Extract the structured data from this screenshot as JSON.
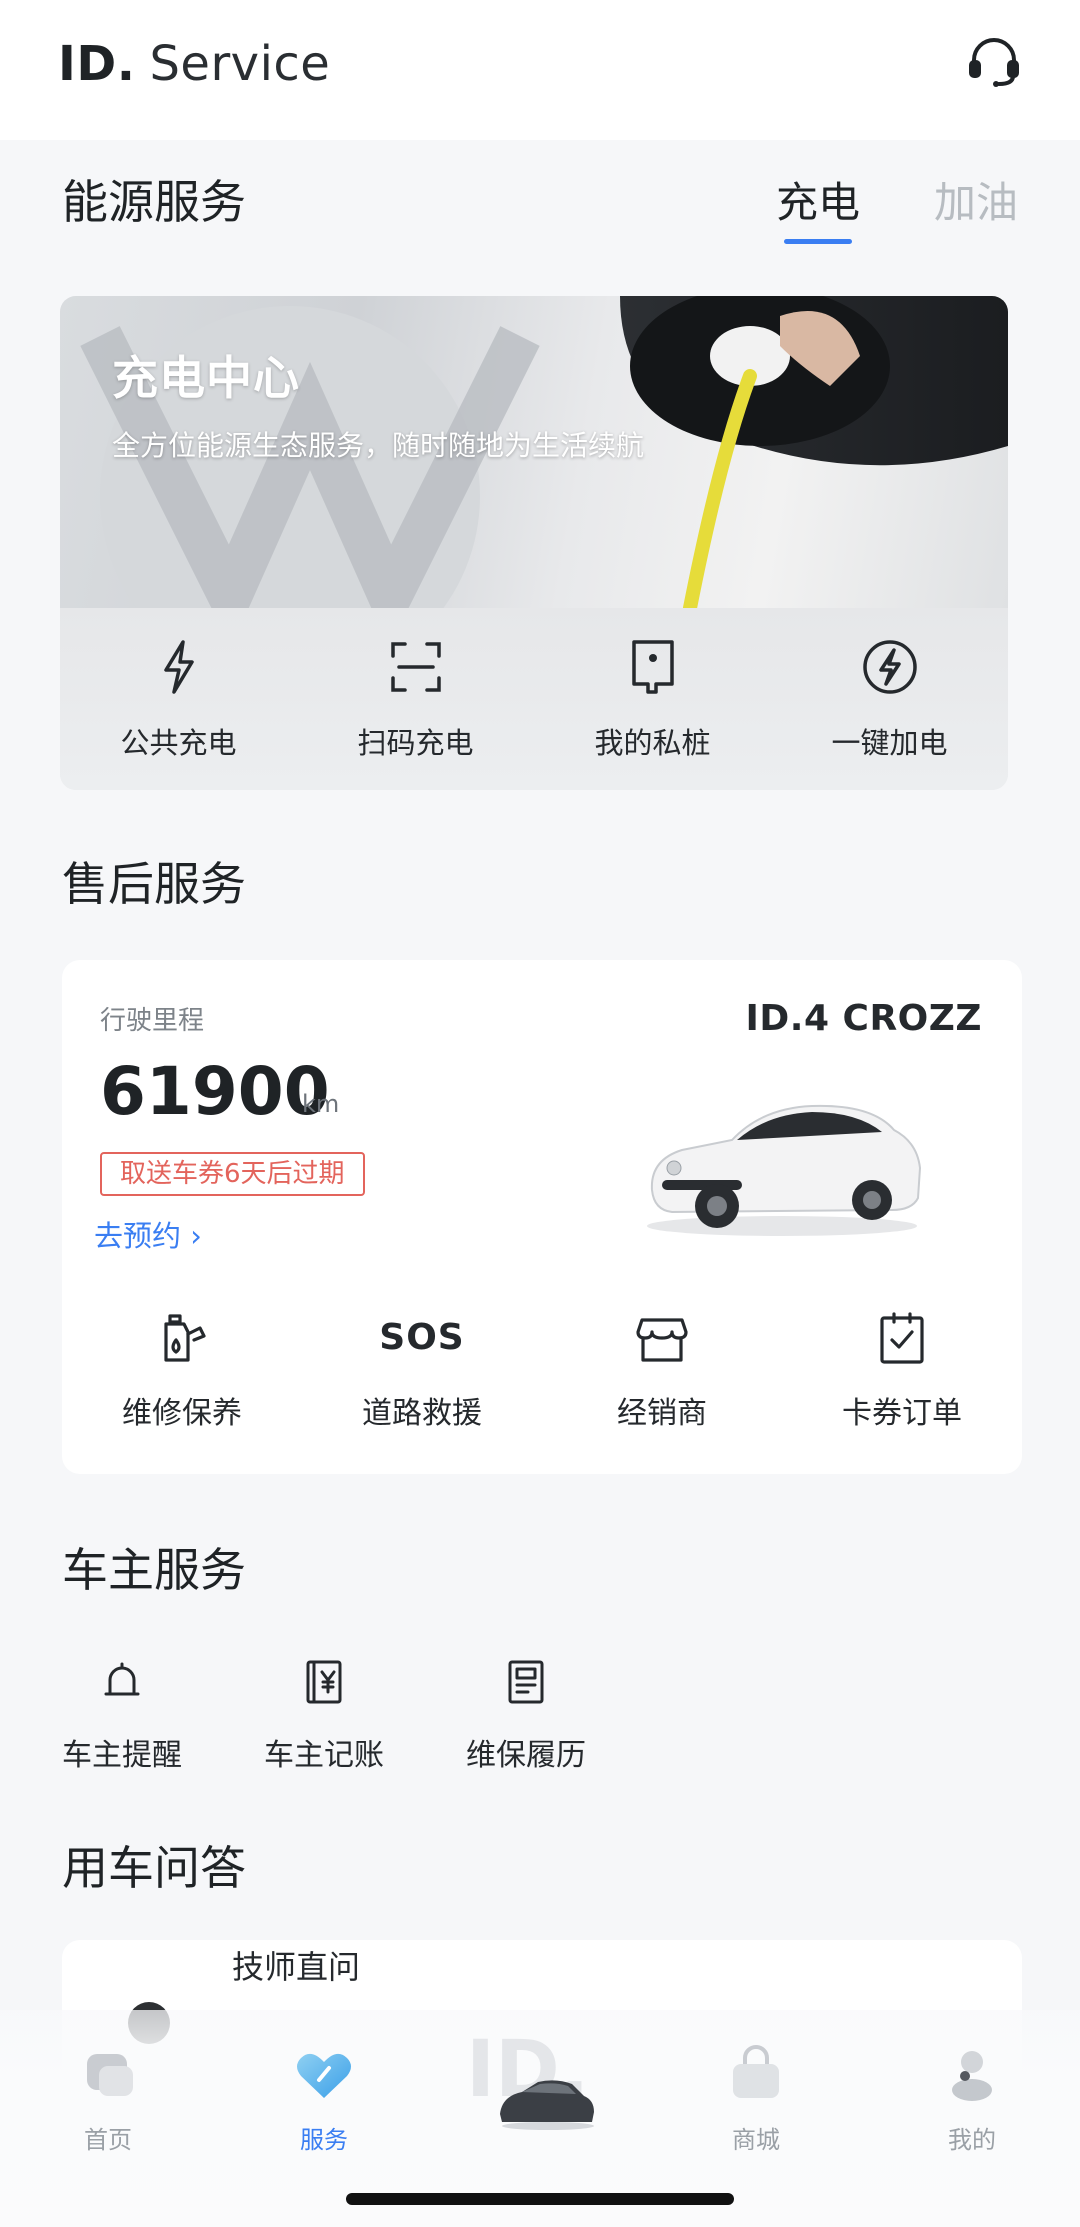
{
  "header": {
    "brand_id": "ID.",
    "brand_service": "Service",
    "support_icon": "headset-icon"
  },
  "energy": {
    "title": "能源服务",
    "tabs": [
      {
        "label": "充电",
        "active": true
      },
      {
        "label": "加油",
        "active": false
      }
    ],
    "banner": {
      "title": "充电中心",
      "subtitle": "全方位能源生态服务，随时随地为生活续航"
    },
    "actions": [
      {
        "label": "公共充电",
        "icon": "lightning-icon"
      },
      {
        "label": "扫码充电",
        "icon": "scan-icon"
      },
      {
        "label": "我的私桩",
        "icon": "charger-pile-icon"
      },
      {
        "label": "一键加电",
        "icon": "bolt-circle-icon"
      }
    ]
  },
  "after_sales": {
    "title": "售后服务",
    "mileage_label": "行驶里程",
    "mileage_value": "61900",
    "mileage_unit": "km",
    "coupon_notice": "取送车券6天后过期",
    "book_link": "去预约 ›",
    "model_name": "ID.4 CROZZ",
    "actions": [
      {
        "label": "维修保养",
        "icon": "oil-can-icon"
      },
      {
        "label": "道路救援",
        "icon": "sos-icon",
        "glyph": "SOS"
      },
      {
        "label": "经销商",
        "icon": "store-icon"
      },
      {
        "label": "卡券订单",
        "icon": "clipboard-check-icon"
      }
    ]
  },
  "owner": {
    "title": "车主服务",
    "actions": [
      {
        "label": "车主提醒",
        "icon": "bell-icon"
      },
      {
        "label": "车主记账",
        "icon": "yen-ledger-icon"
      },
      {
        "label": "维保履历",
        "icon": "document-icon"
      }
    ]
  },
  "qa": {
    "title": "用车问答",
    "first_item": "技师直问"
  },
  "tabbar": {
    "items": [
      {
        "label": "首页",
        "icon": "home-icon",
        "active": false
      },
      {
        "label": "服务",
        "icon": "heart-icon",
        "active": true
      },
      {
        "label": "",
        "icon": "id-car-icon",
        "active": false,
        "center": true,
        "badge_text": "ID."
      },
      {
        "label": "商城",
        "icon": "shopping-bag-icon",
        "active": false
      },
      {
        "label": "我的",
        "icon": "profile-icon",
        "active": false
      }
    ]
  },
  "colors": {
    "accent": "#3a7ef2",
    "warning": "#e3645c",
    "text": "#1f2326",
    "muted": "#b7bcc1"
  }
}
